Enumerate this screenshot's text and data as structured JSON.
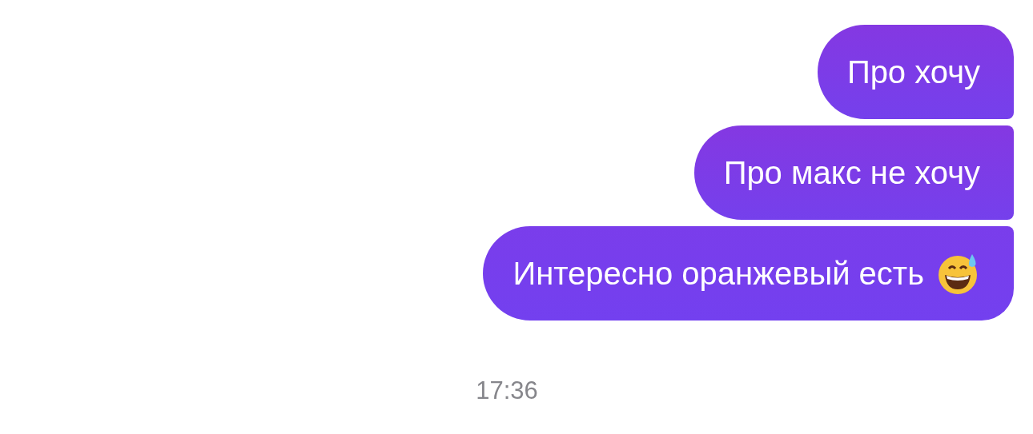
{
  "messages": [
    {
      "kind": "text",
      "text": "Про хочу"
    },
    {
      "kind": "text",
      "text": "Про макс не хочу"
    },
    {
      "kind": "emoji",
      "text": "Интересно оранжевый есть"
    }
  ],
  "timestamp": "17:36"
}
